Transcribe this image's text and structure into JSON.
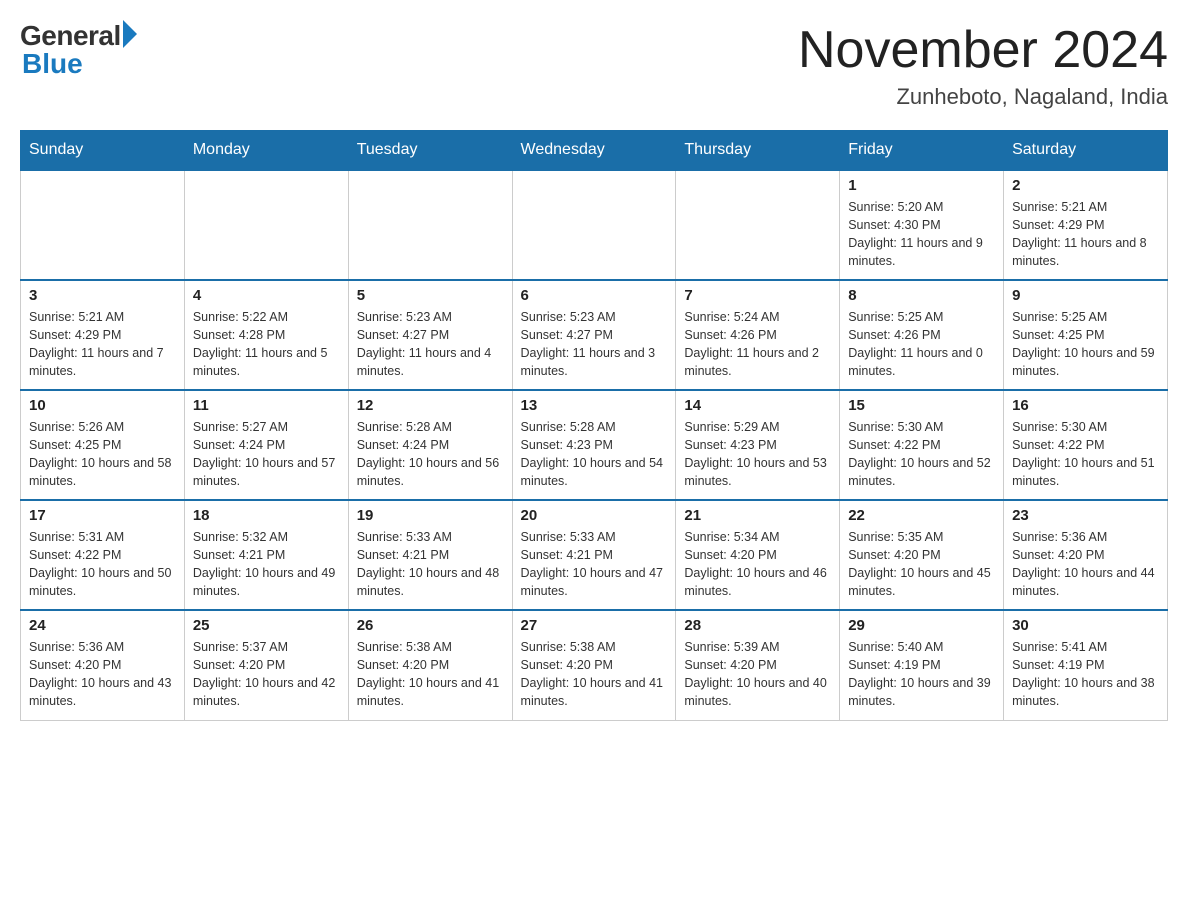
{
  "header": {
    "logo_general": "General",
    "logo_blue": "Blue",
    "month_title": "November 2024",
    "location": "Zunheboto, Nagaland, India"
  },
  "weekdays": [
    "Sunday",
    "Monday",
    "Tuesday",
    "Wednesday",
    "Thursday",
    "Friday",
    "Saturday"
  ],
  "weeks": [
    [
      {
        "day": "",
        "info": ""
      },
      {
        "day": "",
        "info": ""
      },
      {
        "day": "",
        "info": ""
      },
      {
        "day": "",
        "info": ""
      },
      {
        "day": "",
        "info": ""
      },
      {
        "day": "1",
        "info": "Sunrise: 5:20 AM\nSunset: 4:30 PM\nDaylight: 11 hours and 9 minutes."
      },
      {
        "day": "2",
        "info": "Sunrise: 5:21 AM\nSunset: 4:29 PM\nDaylight: 11 hours and 8 minutes."
      }
    ],
    [
      {
        "day": "3",
        "info": "Sunrise: 5:21 AM\nSunset: 4:29 PM\nDaylight: 11 hours and 7 minutes."
      },
      {
        "day": "4",
        "info": "Sunrise: 5:22 AM\nSunset: 4:28 PM\nDaylight: 11 hours and 5 minutes."
      },
      {
        "day": "5",
        "info": "Sunrise: 5:23 AM\nSunset: 4:27 PM\nDaylight: 11 hours and 4 minutes."
      },
      {
        "day": "6",
        "info": "Sunrise: 5:23 AM\nSunset: 4:27 PM\nDaylight: 11 hours and 3 minutes."
      },
      {
        "day": "7",
        "info": "Sunrise: 5:24 AM\nSunset: 4:26 PM\nDaylight: 11 hours and 2 minutes."
      },
      {
        "day": "8",
        "info": "Sunrise: 5:25 AM\nSunset: 4:26 PM\nDaylight: 11 hours and 0 minutes."
      },
      {
        "day": "9",
        "info": "Sunrise: 5:25 AM\nSunset: 4:25 PM\nDaylight: 10 hours and 59 minutes."
      }
    ],
    [
      {
        "day": "10",
        "info": "Sunrise: 5:26 AM\nSunset: 4:25 PM\nDaylight: 10 hours and 58 minutes."
      },
      {
        "day": "11",
        "info": "Sunrise: 5:27 AM\nSunset: 4:24 PM\nDaylight: 10 hours and 57 minutes."
      },
      {
        "day": "12",
        "info": "Sunrise: 5:28 AM\nSunset: 4:24 PM\nDaylight: 10 hours and 56 minutes."
      },
      {
        "day": "13",
        "info": "Sunrise: 5:28 AM\nSunset: 4:23 PM\nDaylight: 10 hours and 54 minutes."
      },
      {
        "day": "14",
        "info": "Sunrise: 5:29 AM\nSunset: 4:23 PM\nDaylight: 10 hours and 53 minutes."
      },
      {
        "day": "15",
        "info": "Sunrise: 5:30 AM\nSunset: 4:22 PM\nDaylight: 10 hours and 52 minutes."
      },
      {
        "day": "16",
        "info": "Sunrise: 5:30 AM\nSunset: 4:22 PM\nDaylight: 10 hours and 51 minutes."
      }
    ],
    [
      {
        "day": "17",
        "info": "Sunrise: 5:31 AM\nSunset: 4:22 PM\nDaylight: 10 hours and 50 minutes."
      },
      {
        "day": "18",
        "info": "Sunrise: 5:32 AM\nSunset: 4:21 PM\nDaylight: 10 hours and 49 minutes."
      },
      {
        "day": "19",
        "info": "Sunrise: 5:33 AM\nSunset: 4:21 PM\nDaylight: 10 hours and 48 minutes."
      },
      {
        "day": "20",
        "info": "Sunrise: 5:33 AM\nSunset: 4:21 PM\nDaylight: 10 hours and 47 minutes."
      },
      {
        "day": "21",
        "info": "Sunrise: 5:34 AM\nSunset: 4:20 PM\nDaylight: 10 hours and 46 minutes."
      },
      {
        "day": "22",
        "info": "Sunrise: 5:35 AM\nSunset: 4:20 PM\nDaylight: 10 hours and 45 minutes."
      },
      {
        "day": "23",
        "info": "Sunrise: 5:36 AM\nSunset: 4:20 PM\nDaylight: 10 hours and 44 minutes."
      }
    ],
    [
      {
        "day": "24",
        "info": "Sunrise: 5:36 AM\nSunset: 4:20 PM\nDaylight: 10 hours and 43 minutes."
      },
      {
        "day": "25",
        "info": "Sunrise: 5:37 AM\nSunset: 4:20 PM\nDaylight: 10 hours and 42 minutes."
      },
      {
        "day": "26",
        "info": "Sunrise: 5:38 AM\nSunset: 4:20 PM\nDaylight: 10 hours and 41 minutes."
      },
      {
        "day": "27",
        "info": "Sunrise: 5:38 AM\nSunset: 4:20 PM\nDaylight: 10 hours and 41 minutes."
      },
      {
        "day": "28",
        "info": "Sunrise: 5:39 AM\nSunset: 4:20 PM\nDaylight: 10 hours and 40 minutes."
      },
      {
        "day": "29",
        "info": "Sunrise: 5:40 AM\nSunset: 4:19 PM\nDaylight: 10 hours and 39 minutes."
      },
      {
        "day": "30",
        "info": "Sunrise: 5:41 AM\nSunset: 4:19 PM\nDaylight: 10 hours and 38 minutes."
      }
    ]
  ]
}
